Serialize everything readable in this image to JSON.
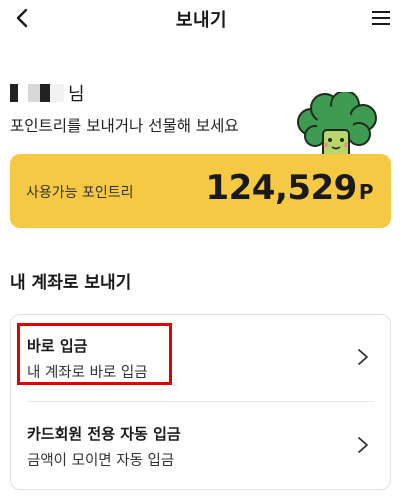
{
  "header": {
    "title": "보내기",
    "back_icon": "chevron-left-icon",
    "menu_icon": "hamburger-menu-icon"
  },
  "greeting": {
    "suffix": "님",
    "subtext": "포인트리를 보내거나 선물해 보세요"
  },
  "points": {
    "label": "사용가능 포인트리",
    "value": "124,529",
    "unit": "P",
    "card_color": "#f6c944"
  },
  "section": {
    "title": "내 계좌로 보내기"
  },
  "options": [
    {
      "title": "바로 입금",
      "subtitle": "내 계좌로 바로 입금",
      "highlighted": true,
      "highlight_color": "#e00000"
    },
    {
      "title": "카드회원 전용 자동 입금",
      "subtitle": "금액이 모이면 자동 입금",
      "highlighted": false
    }
  ]
}
